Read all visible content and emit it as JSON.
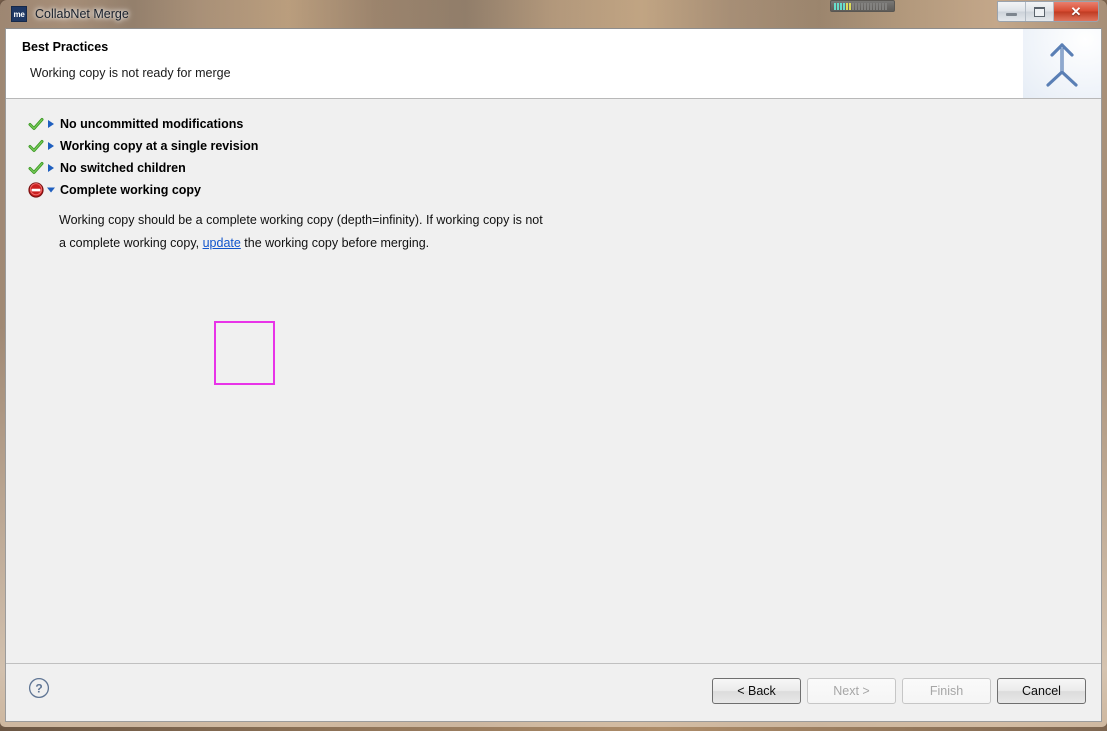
{
  "window": {
    "title": "CollabNet Merge",
    "app_icon_text": "me",
    "app_icon_name": "collabnet-merge-icon",
    "controls": {
      "minimize_label": "Minimize",
      "maximize_label": "Maximize",
      "close_label": "Close",
      "close_glyph": "✕"
    }
  },
  "header": {
    "title": "Best Practices",
    "subtitle": "Working copy is not ready for merge",
    "banner_icon": "merge-arrow-icon"
  },
  "checklist": [
    {
      "label": "No uncommitted modifications",
      "status": "ok",
      "status_icon": "green-check-icon",
      "expanded": false,
      "twisty": "collapsed"
    },
    {
      "label": "Working copy at a single revision",
      "status": "ok",
      "status_icon": "green-check-icon",
      "expanded": false,
      "twisty": "collapsed"
    },
    {
      "label": "No switched children",
      "status": "ok",
      "status_icon": "green-check-icon",
      "expanded": false,
      "twisty": "collapsed"
    },
    {
      "label": "Complete working copy",
      "status": "error",
      "status_icon": "red-error-icon",
      "expanded": true,
      "twisty": "expanded"
    }
  ],
  "detail": {
    "line1": "Working copy should be a complete working copy (depth=infinity).  If working copy is not",
    "line2_before": "a complete working copy, ",
    "link_text": "update",
    "line2_after": " the working copy before merging."
  },
  "annotation": {
    "shape": "rectangle",
    "color": "#e833e8",
    "target": "update-link"
  },
  "footer": {
    "help_label": "?",
    "buttons": [
      {
        "label": "< Back",
        "enabled": true,
        "name": "back-button"
      },
      {
        "label": "Next >",
        "enabled": false,
        "name": "next-button"
      },
      {
        "label": "Finish",
        "enabled": false,
        "name": "finish-button"
      },
      {
        "label": "Cancel",
        "enabled": true,
        "name": "cancel-button"
      }
    ]
  },
  "colors": {
    "link": "#1155cc",
    "ok": "#3f9b27",
    "error": "#cc2020",
    "annotation": "#e833e8",
    "content_bg": "#f0f0f0",
    "header_bg": "#ffffff",
    "titlebar_accent": "#1f3864"
  }
}
